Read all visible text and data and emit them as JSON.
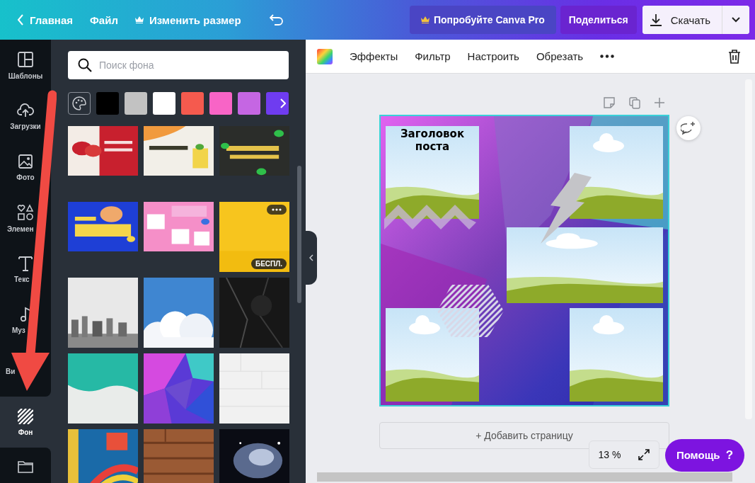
{
  "topbar": {
    "back": "Главная",
    "file": "Файл",
    "resize": "Изменить размер",
    "pro": "Попробуйте Canva Pro",
    "share": "Поделиться",
    "download": "Скачать"
  },
  "sidebar": {
    "items": [
      {
        "label": "Шаблоны",
        "selected": false
      },
      {
        "label": "Загрузки",
        "selected": false
      },
      {
        "label": "Фото",
        "selected": false
      },
      {
        "label": "Элемен",
        "selected": false
      },
      {
        "label": "Текс",
        "selected": false
      },
      {
        "label": "Муз",
        "selected": false
      },
      {
        "label": "Ви",
        "selected": false
      },
      {
        "label": "Фон",
        "selected": true
      }
    ]
  },
  "panel": {
    "search": {
      "placeholder": "Поиск фона"
    },
    "swatches": [
      {
        "color": "#000000"
      },
      {
        "color": "#c2c2c2"
      },
      {
        "color": "#ffffff"
      },
      {
        "color": "#f55a4e"
      },
      {
        "color": "#f864c6"
      },
      {
        "color": "#c566e3"
      },
      {
        "color": "#6f3cf0"
      }
    ],
    "thumbnails": [
      {
        "kind": "picture"
      },
      {
        "kind": "picture"
      },
      {
        "kind": "picture"
      },
      {
        "kind": "picture"
      },
      {
        "kind": "picture"
      },
      {
        "kind": "picture",
        "badge": "БЕСПЛ.",
        "menu": true
      },
      {
        "kind": "picture"
      },
      {
        "kind": "picture"
      },
      {
        "kind": "picture"
      },
      {
        "kind": "picture"
      },
      {
        "kind": "picture"
      },
      {
        "kind": "picture"
      },
      {
        "kind": "picture"
      },
      {
        "kind": "picture"
      },
      {
        "kind": "picture"
      }
    ]
  },
  "toolbar": {
    "items": [
      "Эффекты",
      "Фильтр",
      "Настроить",
      "Обрезать"
    ]
  },
  "design": {
    "title": "Заголовок поста"
  },
  "add_page": "+ Добавить страницу",
  "zoom": "13 %",
  "help": {
    "label": "Помощь",
    "icon": "?"
  }
}
